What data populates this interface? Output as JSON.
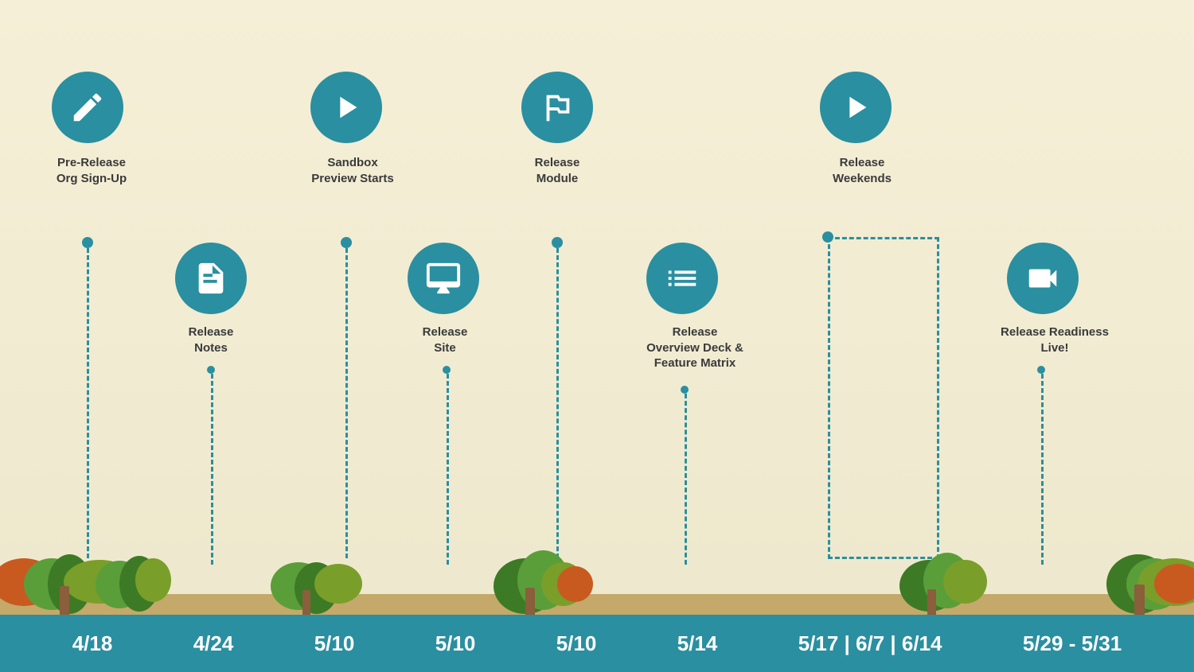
{
  "background_color": "#f5efd7",
  "accent_color": "#2a8fa0",
  "nodes": [
    {
      "id": "pre-release",
      "label": "Pre-Release\nOrg Sign-Up",
      "icon": "pencil",
      "date": "4/18",
      "x_pct": 7,
      "row": "top"
    },
    {
      "id": "release-notes",
      "label": "Release\nNotes",
      "icon": "document",
      "date": "4/24",
      "x_pct": 18,
      "row": "bottom"
    },
    {
      "id": "sandbox-preview",
      "label": "Sandbox\nPreview Starts",
      "icon": "play",
      "date": "5/10",
      "x_pct": 29,
      "row": "top"
    },
    {
      "id": "release-site",
      "label": "Release\nSite",
      "icon": "monitor",
      "date": "5/10",
      "x_pct": 39,
      "row": "bottom"
    },
    {
      "id": "release-module",
      "label": "Release\nModule",
      "icon": "mountain",
      "date": "5/10",
      "x_pct": 50,
      "row": "top"
    },
    {
      "id": "release-overview",
      "label": "Release\nOverview Deck &\nFeature Matrix",
      "icon": "list",
      "date": "5/14",
      "x_pct": 60,
      "row": "bottom"
    },
    {
      "id": "release-weekends",
      "label": "Release\nWeekends",
      "icon": "play",
      "date": "5/17 | 6/7 | 6/14",
      "x_pct": 75,
      "row": "top"
    },
    {
      "id": "release-readiness",
      "label": "Release Readiness\nLive!",
      "icon": "video",
      "date": "5/29 - 5/31",
      "x_pct": 90,
      "row": "bottom"
    }
  ],
  "dates": [
    {
      "label": "4/18",
      "x_pct": 7
    },
    {
      "label": "4/24",
      "x_pct": 18
    },
    {
      "label": "5/10",
      "x_pct": 29
    },
    {
      "label": "5/10",
      "x_pct": 39
    },
    {
      "label": "5/10",
      "x_pct": 50
    },
    {
      "label": "5/14",
      "x_pct": 60
    },
    {
      "label": "5/17 | 6/7 | 6/14",
      "x_pct": 75
    },
    {
      "label": "5/29 - 5/31",
      "x_pct": 90
    }
  ]
}
